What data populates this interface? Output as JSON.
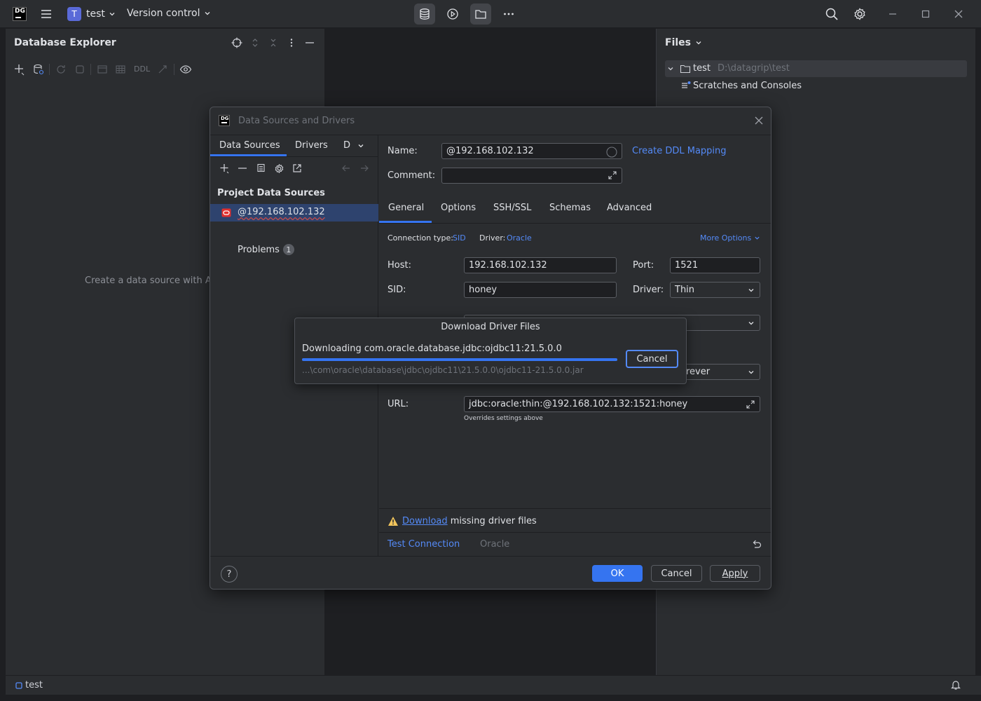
{
  "titlebar": {
    "app_logo": "DG",
    "project_initial": "T",
    "project_name": "test",
    "vcs_label": "Version control",
    "icons": [
      "hamburger-menu-icon",
      "database-icon",
      "run-icon",
      "folder-icon",
      "more-icon",
      "search-icon",
      "settings-icon",
      "minimize-icon",
      "maximize-icon",
      "close-icon"
    ]
  },
  "left_panel": {
    "title": "Database Explorer",
    "toolbar_ddl": "DDL",
    "empty_hint": "Create a data source with Al"
  },
  "right_panel": {
    "title": "Files",
    "tree": [
      {
        "name": "test",
        "path": "D:\\datagrip\\test"
      },
      {
        "name": "Scratches and Consoles"
      }
    ]
  },
  "statusbar": {
    "project": "test"
  },
  "dialog": {
    "title": "Data Sources and Drivers",
    "sidebar": {
      "tabs": [
        "Data Sources",
        "Drivers",
        "D"
      ],
      "section_title": "Project Data Sources",
      "selected_source": "@192.168.102.132",
      "problems_label": "Problems",
      "problems_count": "1"
    },
    "name_label": "Name:",
    "name_value": "@192.168.102.132",
    "create_ddl_link": "Create DDL Mapping",
    "comment_label": "Comment:",
    "comment_value": "",
    "tabs": [
      "General",
      "Options",
      "SSH/SSL",
      "Schemas",
      "Advanced"
    ],
    "connection_type_label": "Connection type:",
    "connection_type_value": "SID",
    "driver_meta_label": "Driver:",
    "driver_meta_value": "Oracle",
    "more_options": "More Options",
    "host_label": "Host:",
    "host_value": "192.168.102.132",
    "port_label": "Port:",
    "port_value": "1521",
    "sid_label": "SID:",
    "sid_value": "honey",
    "driver_label": "Driver:",
    "driver_value": "Thin",
    "partial_select_value": "rever",
    "url_label": "URL:",
    "url_value": "jdbc:oracle:thin:@192.168.102.132:1521:honey",
    "url_note": "Overrides settings above",
    "warning_link": "Download",
    "warning_text": " missing driver files",
    "test_connection": "Test Connection",
    "test_driver": "Oracle",
    "ok": "OK",
    "cancel": "Cancel",
    "apply": "Apply"
  },
  "progress_popup": {
    "title": "Download Driver Files",
    "status": "Downloading com.oracle.database.jdbc:ojdbc11:21.5.0.0",
    "progress_fraction": 1.0,
    "file": "...\\com\\oracle\\database\\jdbc\\ojdbc11\\21.5.0.0\\ojdbc11-21.5.0.0.jar",
    "cancel": "Cancel"
  },
  "colors": {
    "accent": "#3574f0",
    "link": "#548af7",
    "panel_bg": "#2b2d30",
    "editor_bg": "#1e1f22",
    "oracle_red": "#e0302f",
    "warning": "#f2c55c"
  }
}
